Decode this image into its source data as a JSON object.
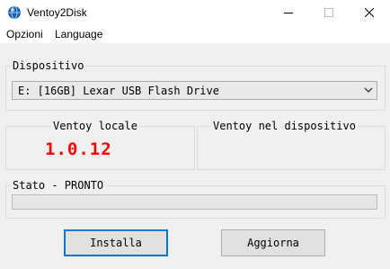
{
  "window": {
    "title": "Ventoy2Disk",
    "icon": "ventoy-globe-icon"
  },
  "menu": {
    "items": [
      "Opzioni",
      "Language"
    ]
  },
  "device": {
    "legend": "Dispositivo",
    "selected": "E: [16GB] Lexar USB Flash Drive"
  },
  "local": {
    "legend": "Ventoy locale",
    "version": "1.0.12",
    "version_color": "#ff0000"
  },
  "on_device": {
    "legend": "Ventoy nel dispositivo",
    "version": ""
  },
  "status": {
    "legend": "Stato - PRONTO",
    "progress": 0
  },
  "buttons": {
    "install": "Installa",
    "update": "Aggiorna"
  },
  "colors": {
    "default_button_border": "#0078d7",
    "window_bg": "#f0f0f0"
  }
}
